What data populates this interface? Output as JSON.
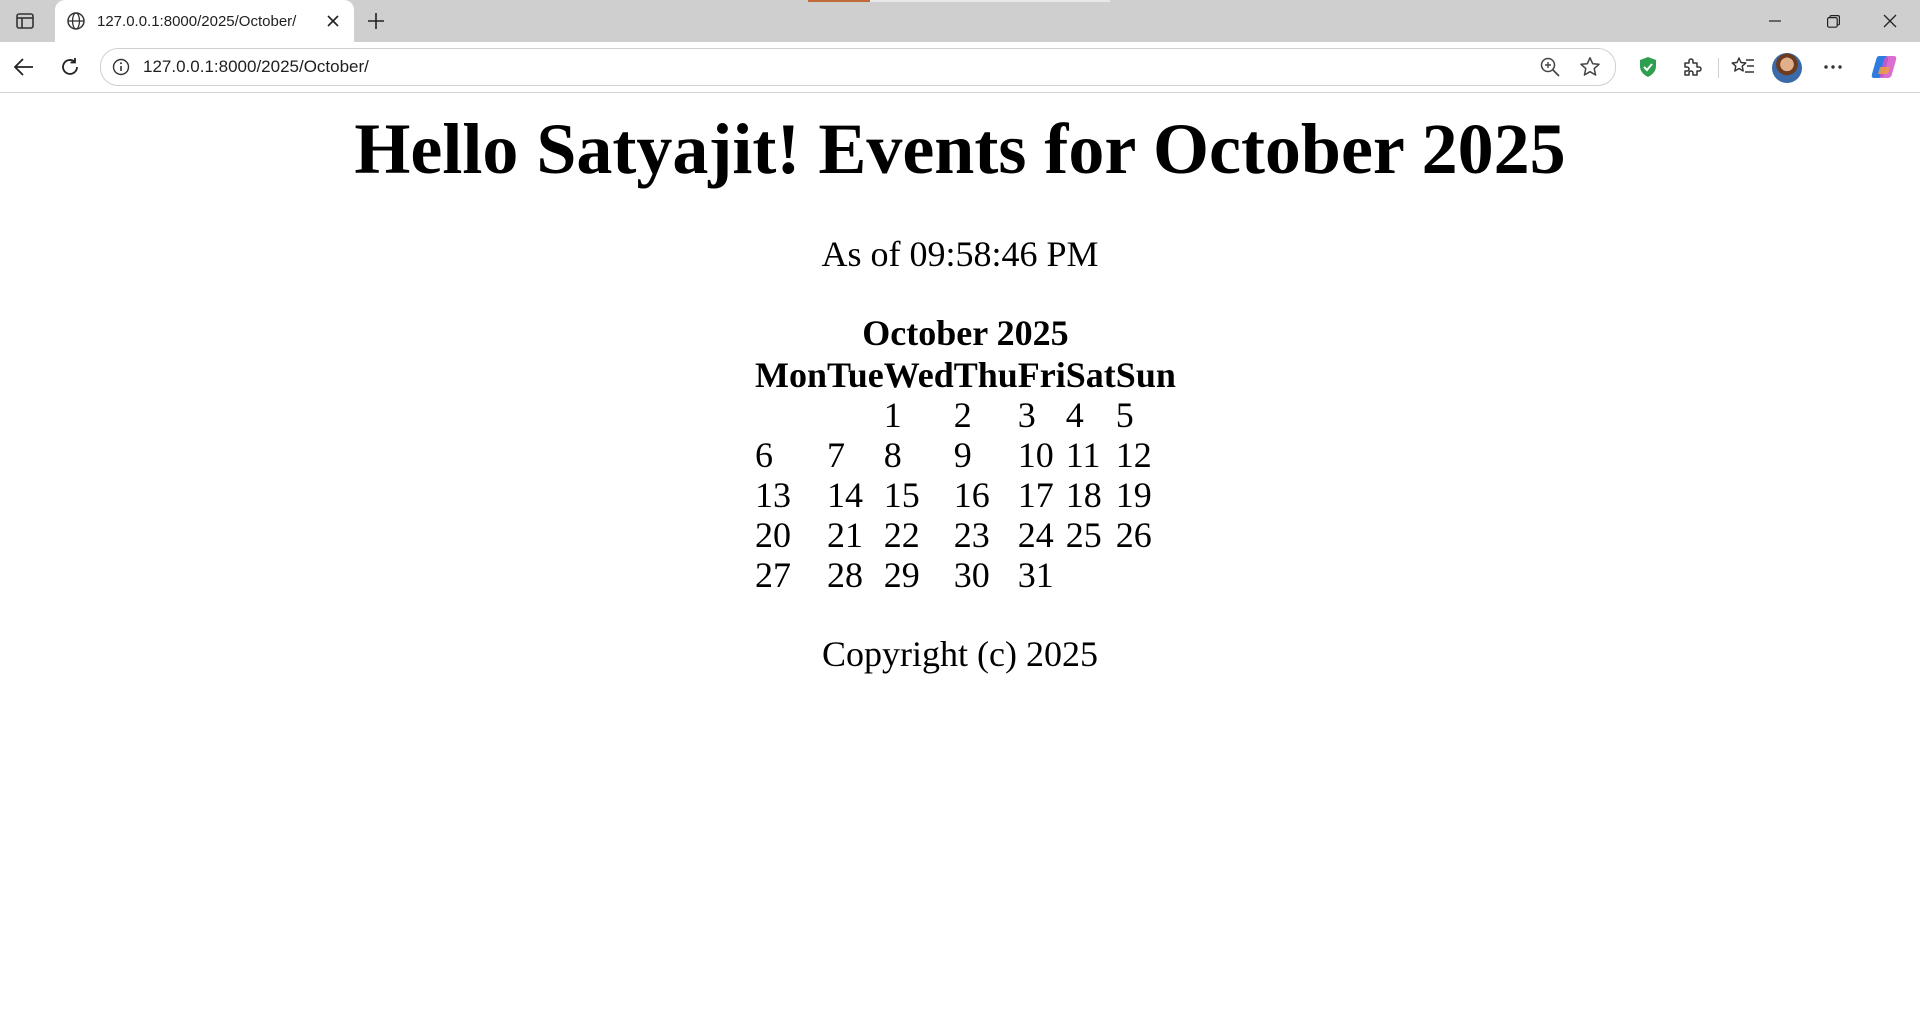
{
  "browser": {
    "tab_title": "127.0.0.1:8000/2025/October/",
    "url": "127.0.0.1:8000/2025/October/"
  },
  "page": {
    "heading": "Hello Satyajit! Events for October 2025",
    "as_of": "As of 09:58:46 PM",
    "calendar": {
      "caption": "October 2025",
      "weekdays": [
        "Mon",
        "Tue",
        "Wed",
        "Thu",
        "Fri",
        "Sat",
        "Sun"
      ],
      "weeks": [
        [
          "",
          "",
          "1",
          "2",
          "3",
          "4",
          "5"
        ],
        [
          "6",
          "7",
          "8",
          "9",
          "10",
          "11",
          "12"
        ],
        [
          "13",
          "14",
          "15",
          "16",
          "17",
          "18",
          "19"
        ],
        [
          "20",
          "21",
          "22",
          "23",
          "24",
          "25",
          "26"
        ],
        [
          "27",
          "28",
          "29",
          "30",
          "31",
          "",
          ""
        ]
      ]
    },
    "copyright": "Copyright (c) 2025"
  }
}
